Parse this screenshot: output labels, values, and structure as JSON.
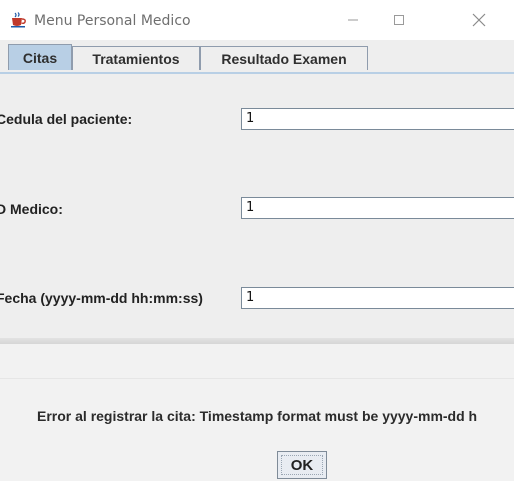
{
  "window": {
    "title": "Menu Personal Medico",
    "icon": "java-cup-icon",
    "controls": [
      "minimize",
      "maximize",
      "close"
    ]
  },
  "tabs": [
    {
      "label": "Citas",
      "active": true
    },
    {
      "label": "Tratamientos",
      "active": false
    },
    {
      "label": "Resultado Examen",
      "active": false
    }
  ],
  "form": {
    "cedula": {
      "label": "Cedula del paciente:",
      "value": "1"
    },
    "id_medico": {
      "label": "D Medico:",
      "value": "1"
    },
    "fecha": {
      "label": "Fecha (yyyy-mm-dd hh:mm:ss)",
      "value": "1"
    }
  },
  "dialog": {
    "message": "Error al registrar la cita: Timestamp format must be yyyy-mm-dd h",
    "ok_label": "OK"
  }
}
